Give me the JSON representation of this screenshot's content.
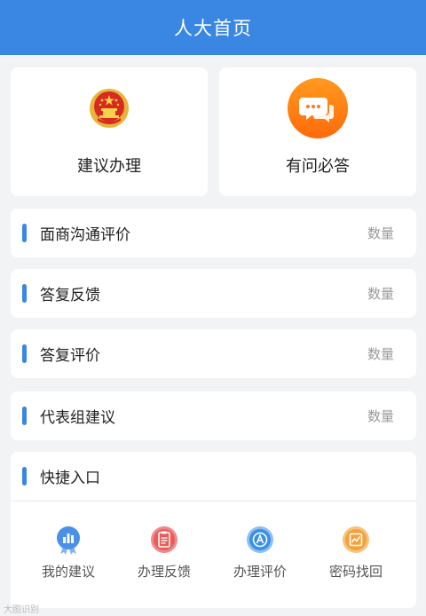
{
  "header": {
    "title": "人大首页"
  },
  "top_cards": [
    {
      "label": "建议办理",
      "icon": "national-emblem-icon"
    },
    {
      "label": "有问必答",
      "icon": "chat-bubbles-icon"
    }
  ],
  "rows": [
    {
      "title": "面商沟通评价",
      "count": "数量"
    },
    {
      "title": "答复反馈",
      "count": "数量"
    },
    {
      "title": "答复评价",
      "count": "数量"
    },
    {
      "title": "代表组建议",
      "count": "数量"
    }
  ],
  "quick": {
    "title": "快捷入口",
    "items": [
      {
        "label": "我的建议",
        "icon": "bar-chart-icon",
        "color": "#4a90e8"
      },
      {
        "label": "办理反馈",
        "icon": "clipboard-icon",
        "color": "#ec5a5a"
      },
      {
        "label": "办理评价",
        "icon": "letter-a-icon",
        "color": "#3b8fe6"
      },
      {
        "label": "密码找回",
        "icon": "image-chart-icon",
        "color": "#f2a23c"
      }
    ]
  },
  "colors": {
    "accent": "#3a87e3",
    "orange": "#ff7a12"
  },
  "watermark": "大图识别"
}
